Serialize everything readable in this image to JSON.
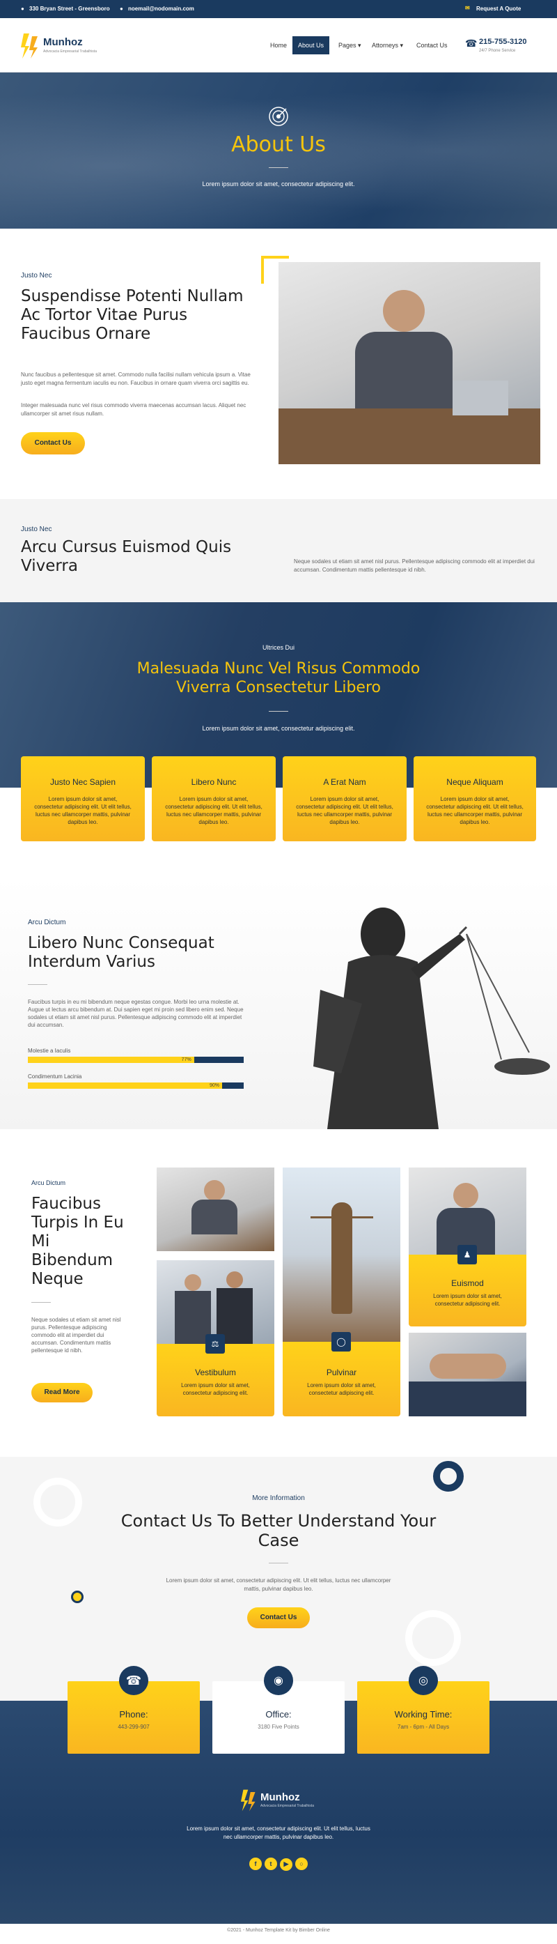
{
  "topbar": {
    "address": "330 Bryan Street - Greensboro",
    "email": "noemail@nodomain.com",
    "quote": "Request A Quote"
  },
  "brand": {
    "name": "Munhoz",
    "tagline": "Advocacia Empresarial Trabalhista",
    "phone": "215-755-3120",
    "phone_note": "24/7 Phone Service"
  },
  "nav": {
    "items": [
      {
        "label": "Home"
      },
      {
        "label": "About Us"
      },
      {
        "label": "Pages"
      },
      {
        "label": "Attorneys"
      },
      {
        "label": "Contact Us"
      }
    ]
  },
  "hero": {
    "title": "About Us",
    "subtitle": "Lorem ipsum dolor sit amet, consectetur adipiscing elit."
  },
  "intro": {
    "eyebrow": "Justo Nec",
    "heading": "Suspendisse Potenti Nullam Ac Tortor Vitae Purus Faucibus Ornare",
    "p1": "Nunc faucibus a pellentesque sit amet. Commodo nulla facilisi nullam vehicula ipsum a. Vitae justo eget magna fermentum iaculis eu non. Faucibus in ornare quam viverra orci sagittis eu.",
    "p2": "Integer malesuada nunc vel risus commodo viverra maecenas accumsan lacus. Aliquet nec ullamcorper sit amet risus nullam.",
    "button": "Contact Us"
  },
  "strip": {
    "eyebrow": "Justo Nec",
    "heading": "Arcu Cursus Euismod Quis Viverra",
    "text": "Neque sodales ut etiam sit amet nisl purus. Pellentesque adipiscing commodo elit at imperdiet dui accumsan. Condimentum mattis pellentesque id nibh."
  },
  "services": {
    "eyebrow": "Ultrices Dui",
    "heading": "Malesuada Nunc Vel Risus Commodo Viverra Consectetur Libero",
    "subtitle": "Lorem ipsum dolor sit amet, consectetur adipiscing elit.",
    "cards": [
      {
        "title": "Justo Nec Sapien",
        "text": "Lorem ipsum dolor sit amet, consectetur adipiscing elit. Ut elit tellus, luctus nec ullamcorper mattis, pulvinar dapibus leo."
      },
      {
        "title": "Libero Nunc",
        "text": "Lorem ipsum dolor sit amet, consectetur adipiscing elit. Ut elit tellus, luctus nec ullamcorper mattis, pulvinar dapibus leo."
      },
      {
        "title": "A Erat Nam",
        "text": "Lorem ipsum dolor sit amet, consectetur adipiscing elit. Ut elit tellus, luctus nec ullamcorper mattis, pulvinar dapibus leo."
      },
      {
        "title": "Neque Aliquam",
        "text": "Lorem ipsum dolor sit amet, consectetur adipiscing elit. Ut elit tellus, luctus nec ullamcorper mattis, pulvinar dapibus leo."
      }
    ]
  },
  "skills": {
    "eyebrow": "Arcu Dictum",
    "heading": "Libero Nunc Consequat Interdum Varius",
    "text": "Faucibus turpis in eu mi bibendum neque egestas congue. Morbi leo urna molestie at. Augue ut lectus arcu bibendum at. Dui sapien eget mi proin sed libero enim sed. Neque sodales ut etiam sit amet nisl purus. Pellentesque adipiscing commodo elit at imperdiet dui accumsan.",
    "bars": [
      {
        "label": "Molestie a Iaculis",
        "percent": 77,
        "text": "77%"
      },
      {
        "label": "Condimentum Lacinia",
        "percent": 90,
        "text": "90%"
      }
    ]
  },
  "practice": {
    "eyebrow": "Arcu Dictum",
    "heading": "Faucibus Turpis In Eu Mi Bibendum Neque",
    "text": "Neque sodales ut etiam sit amet nisl purus. Pellentesque adipiscing commodo elit at imperdiet dui accumsan. Condimentum mattis pellentesque id nibh.",
    "button": "Read More",
    "cards": [
      {
        "title": "Vestibulum",
        "text": "Lorem ipsum dolor sit amet, consectetur adipiscing elit."
      },
      {
        "title": "Pulvinar",
        "text": "Lorem ipsum dolor sit amet, consectetur adipiscing elit."
      },
      {
        "title": "Euismod",
        "text": "Lorem ipsum dolor sit amet, consectetur adipiscing elit."
      }
    ]
  },
  "contact": {
    "eyebrow": "More Information",
    "heading": "Contact Us To Better Understand Your Case",
    "text": "Lorem ipsum dolor sit amet, consectetur adipiscing elit. Ut elit tellus, luctus nec ullamcorper mattis, pulvinar dapibus leo.",
    "button": "Contact Us",
    "boxes": [
      {
        "title": "Phone:",
        "value": "443-299-907"
      },
      {
        "title": "Office:",
        "value": "3180 Five Points"
      },
      {
        "title": "Working Time:",
        "value": "7am - 6pm - All Days"
      }
    ]
  },
  "footer": {
    "text": "Lorem ipsum dolor sit amet, consectetur adipiscing elit. Ut elit tellus, luctus nec ullamcorper mattis, pulvinar dapibus leo.",
    "copyright": "©2021 - Munhoz Template Kit by Bimber Online"
  },
  "colors": {
    "navy": "#1a3a5f",
    "yellow": "#ffd21a",
    "gold": "#f7ad1d"
  }
}
